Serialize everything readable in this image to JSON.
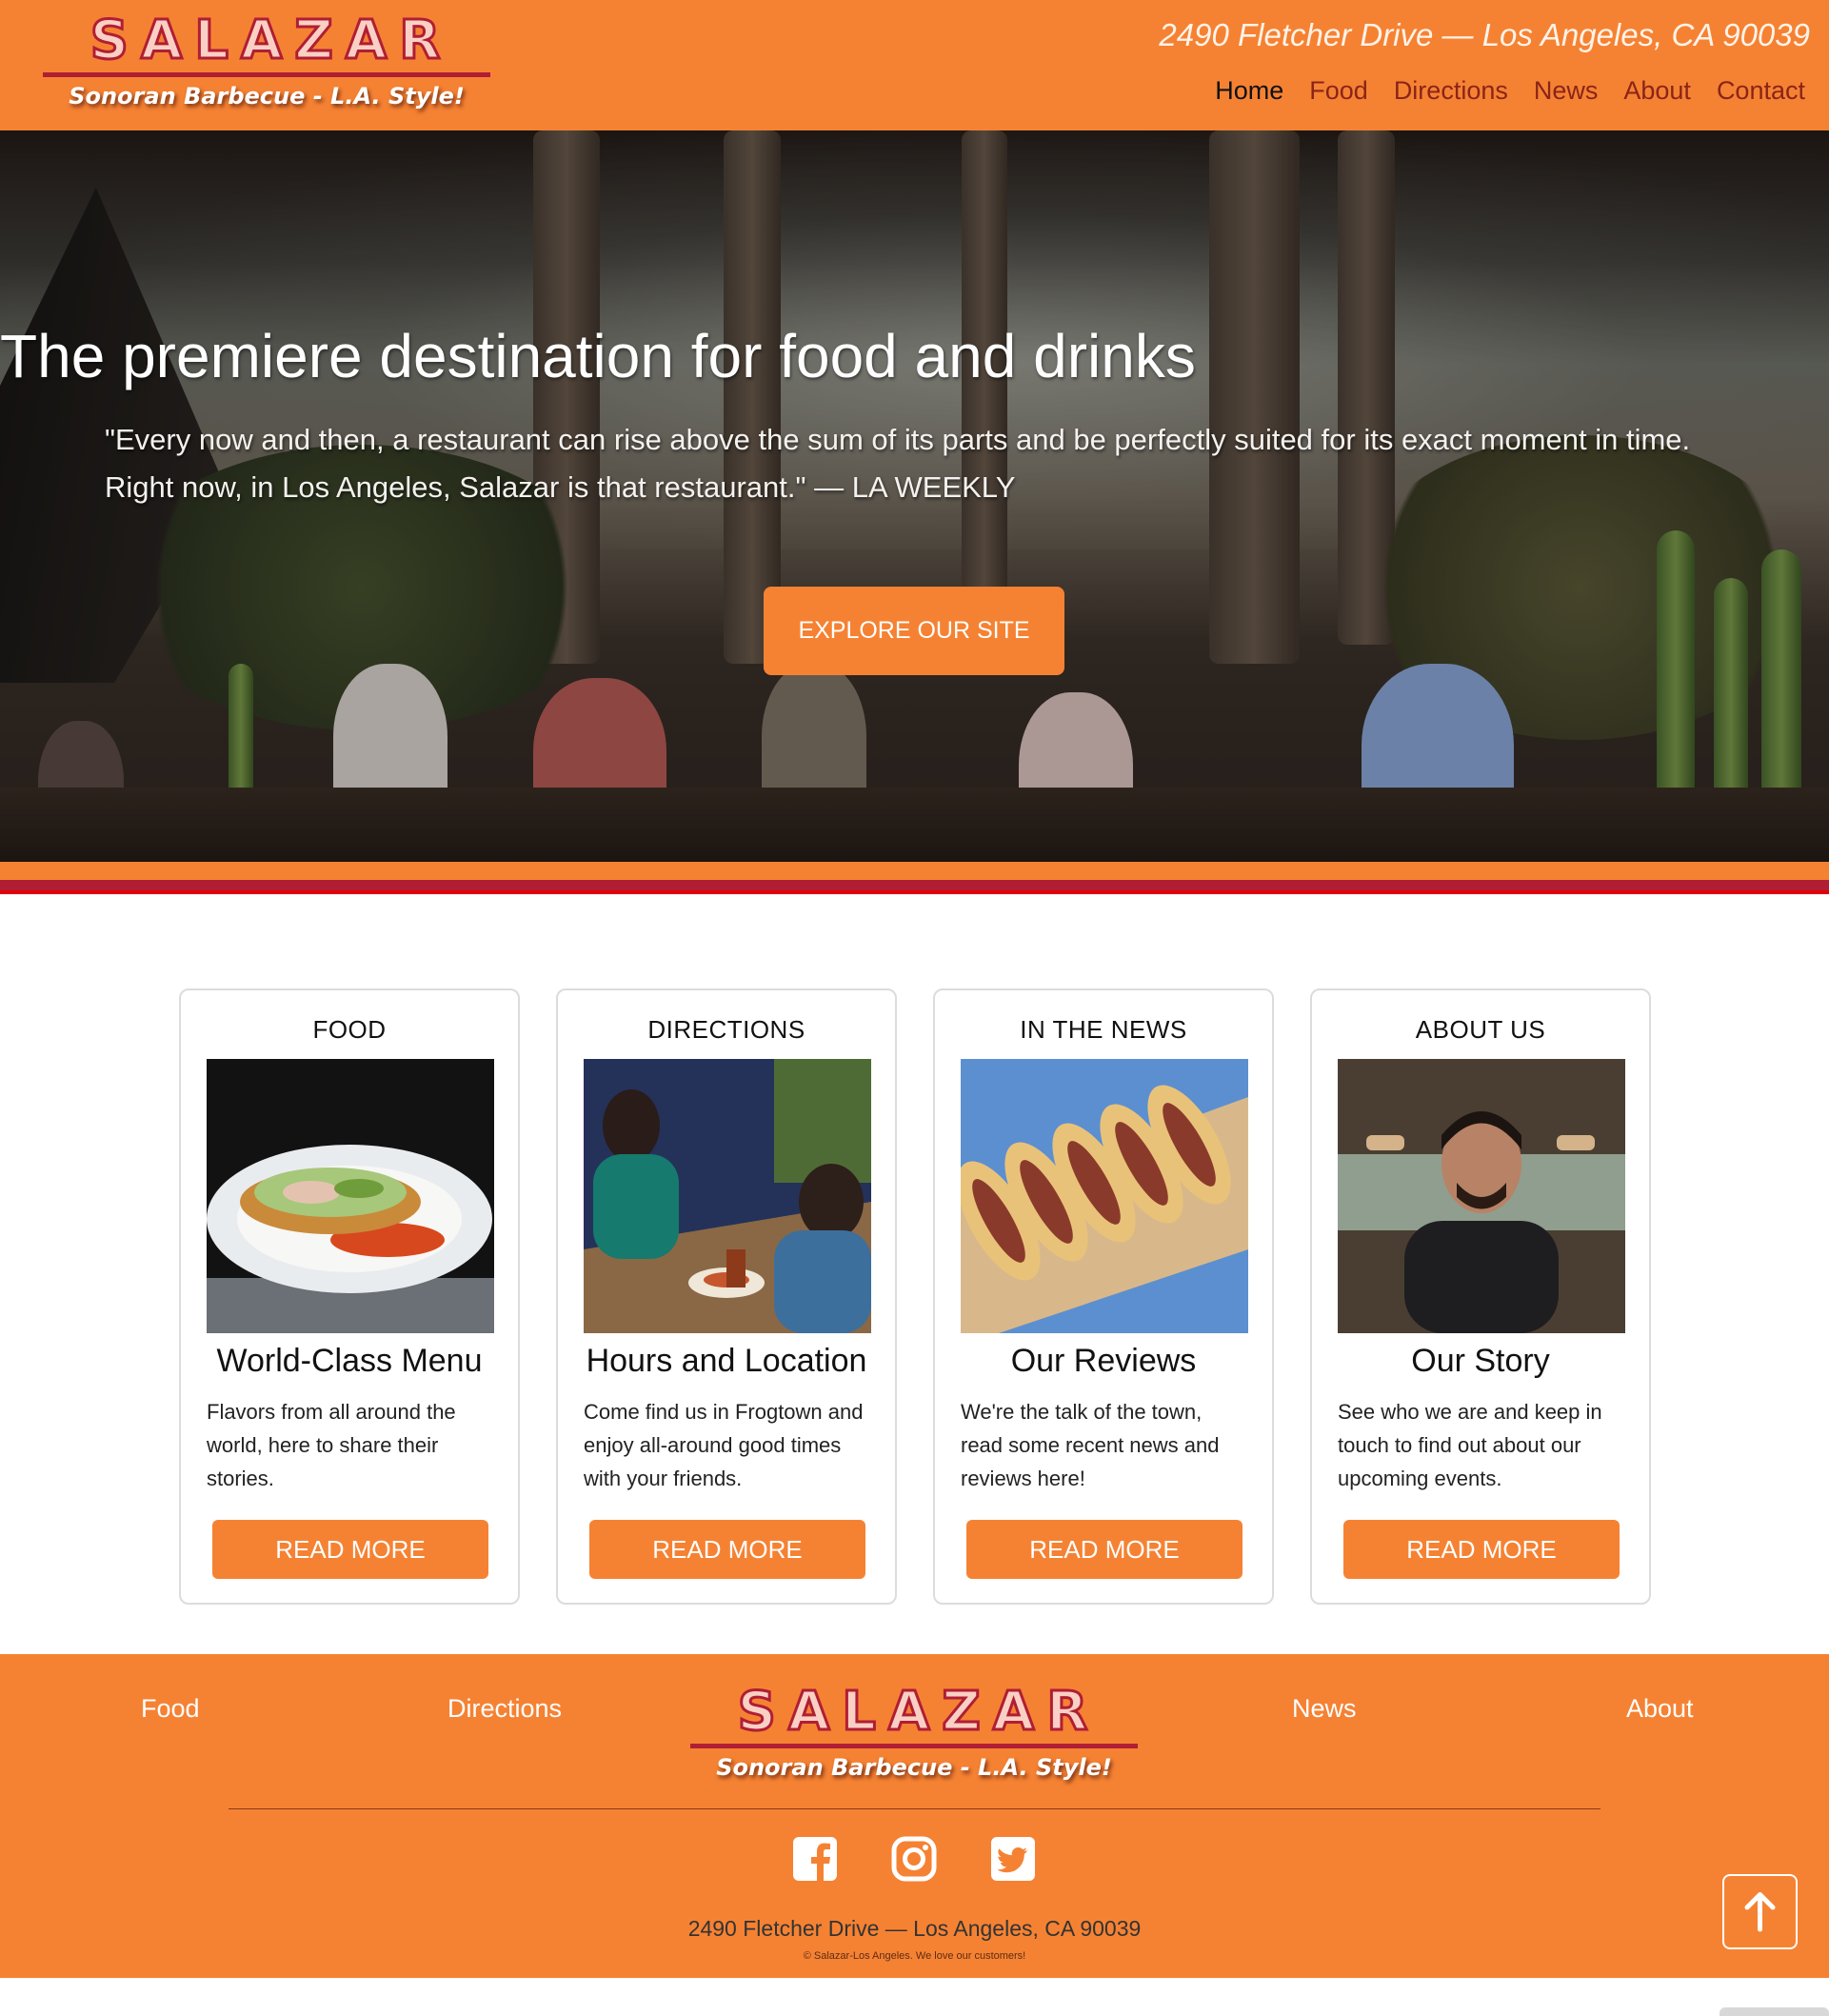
{
  "header": {
    "logo_word": "SALAZAR",
    "logo_tagline": "Sonoran Barbecue - L.A. Style!",
    "address": "2490 Fletcher Drive — Los Angeles, CA 90039",
    "nav": [
      {
        "label": "Home",
        "active": true
      },
      {
        "label": "Food"
      },
      {
        "label": "Directions"
      },
      {
        "label": "News"
      },
      {
        "label": "About"
      },
      {
        "label": "Contact"
      }
    ]
  },
  "hero": {
    "title": "The premiere destination for food and drinks",
    "quote": "\"Every now and then, a restaurant can rise above the sum of its parts and be perfectly suited for its exact moment in time. Right now, in Los Angeles, Salazar is that restaurant.\" — LA WEEKLY",
    "button_label": "EXPLORE OUR SITE"
  },
  "cards": [
    {
      "heading": "FOOD",
      "title": "World-Class Menu",
      "text": "Flavors from all around the world, here to share their stories.",
      "button": "READ MORE"
    },
    {
      "heading": "DIRECTIONS",
      "title": "Hours and Location",
      "text": "Come find us in Frogtown and enjoy all-around good times with your friends.",
      "button": "READ MORE"
    },
    {
      "heading": "IN THE NEWS",
      "title": "Our Reviews",
      "text": "We're the talk of the town, read some recent news and reviews here!",
      "button": "READ MORE"
    },
    {
      "heading": "ABOUT US",
      "title": "Our Story",
      "text": "See who we are and keep in touch to find out about our upcoming events.",
      "button": "READ MORE"
    }
  ],
  "footer": {
    "links": [
      "Food",
      "Directions",
      "News",
      "About"
    ],
    "logo_word": "SALAZAR",
    "logo_tagline": "Sonoran Barbecue - L.A. Style!",
    "social": [
      "facebook-icon",
      "instagram-icon",
      "twitter-icon"
    ],
    "address": "2490 Fletcher Drive — Los Angeles, CA 90039",
    "copyright": "© Salazar-Los Angeles. We love our customers!"
  },
  "colors": {
    "brand_orange": "#f58233",
    "brand_red": "#b01e34"
  }
}
